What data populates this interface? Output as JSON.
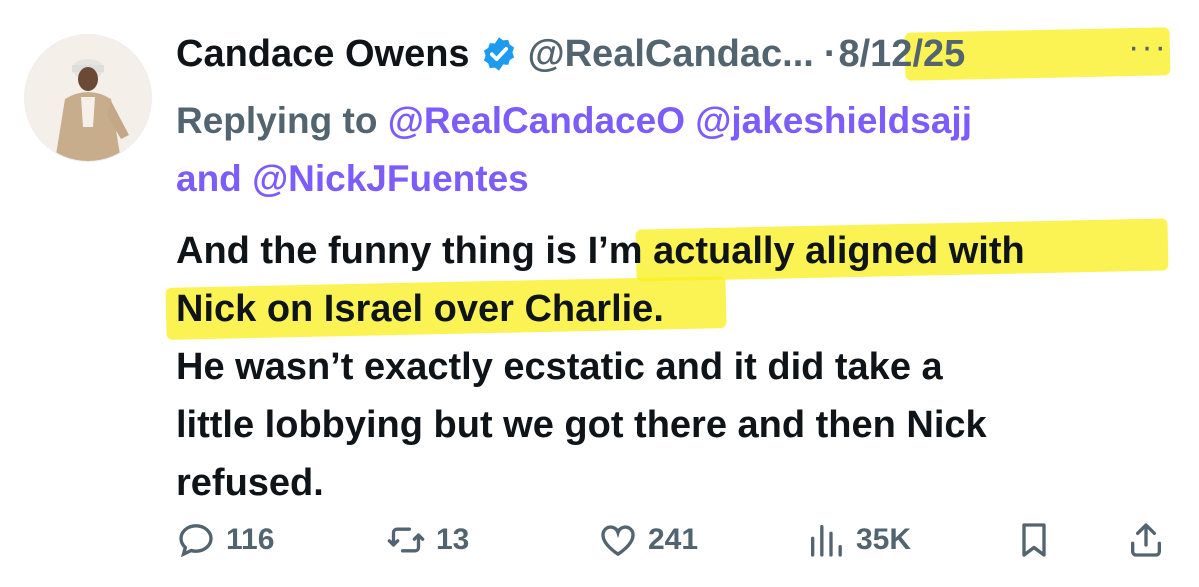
{
  "tweet": {
    "author_name": "Candace Owens",
    "handle": "@RealCandac...",
    "separator": "·",
    "date": "8/12/25",
    "more": "···",
    "reply": {
      "prefix": "Replying to ",
      "mention1": "@RealCandaceO",
      "mention2": "@jakeshieldsajj",
      "conjunction": "and ",
      "mention3": "@NickJFuentes"
    },
    "text": {
      "part1": "And the funny thing is ",
      "highlight1": "I’m actually aligned with",
      "highlight2": "Nick on Israel over Charlie",
      "part2": ".",
      "line3": "He wasn’t exactly ecstatic and it did take a",
      "line4": "little lobbying but we got there and then Nick",
      "line5": "refused."
    }
  },
  "metrics": {
    "replies": "116",
    "reposts": "13",
    "likes": "241",
    "views": "35K"
  },
  "icons": {
    "verified": "verified-badge-icon",
    "reply": "reply-icon",
    "repost": "repost-icon",
    "like": "heart-icon",
    "views": "views-icon",
    "bookmark": "bookmark-icon",
    "share": "share-icon"
  },
  "colors": {
    "highlight": "#faf023",
    "link": "#7c5cfa",
    "muted": "#536471",
    "verified": "#1d9bf0"
  }
}
